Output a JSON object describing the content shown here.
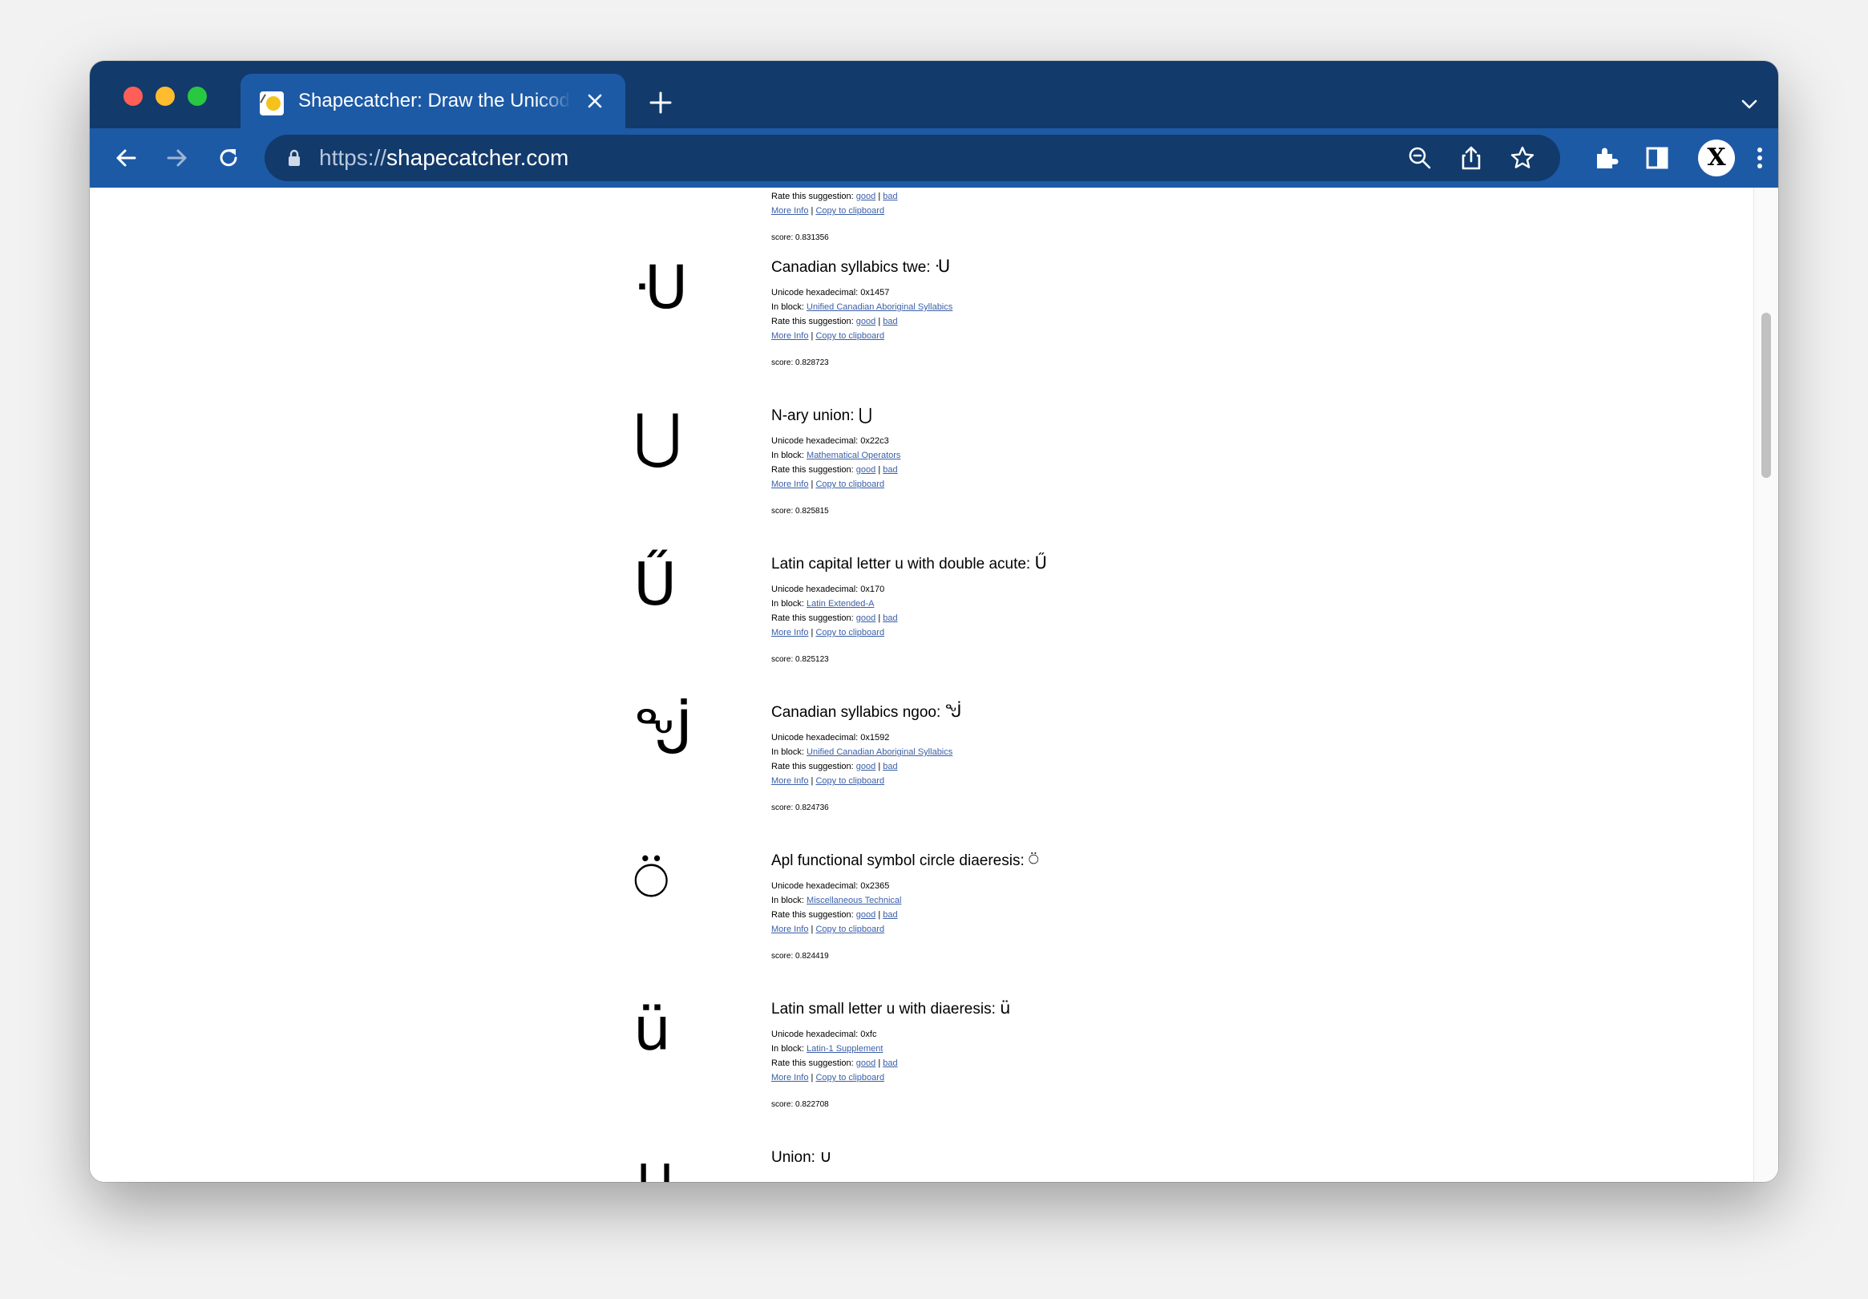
{
  "browser": {
    "tab_title": "Shapecatcher: Draw the Unicode character you want!",
    "url_scheme": "https://",
    "url_host": "shapecatcher.com",
    "profile_initial": "X"
  },
  "colors": {
    "tabbar_bg": "#123a6b",
    "toolbar_bg": "#1d5aa6",
    "link": "#3a5fa8"
  },
  "labels": {
    "rate_prefix": "Rate this suggestion: ",
    "good": "good",
    "bad": "bad",
    "separator": " | ",
    "more_info": "More Info",
    "copy": "Copy to clipboard",
    "hex_prefix": "Unicode hexadecimal: ",
    "block_prefix": "In block: ",
    "score_prefix": "score: "
  },
  "previous_entry": {
    "score": "0.831356"
  },
  "results": [
    {
      "glyph": "ᑗ",
      "name": "Canadian syllabics twe: ",
      "char": "ᑗ",
      "hex": "0x1457",
      "block": "Unified Canadian Aboriginal Syllabics",
      "score": "0.828723"
    },
    {
      "glyph": "⋃",
      "name": "N-ary union: ",
      "char": "⋃",
      "hex": "0x22c3",
      "block": "Mathematical Operators",
      "score": "0.825815"
    },
    {
      "glyph": "Ű",
      "name": "Latin capital letter u with double acute: ",
      "char": "Ű",
      "hex": "0x170",
      "block": "Latin Extended-A",
      "score": "0.825123"
    },
    {
      "glyph": "ᖒ",
      "name": "Canadian syllabics ngoo: ",
      "char": "ᖒ",
      "hex": "0x1592",
      "block": "Unified Canadian Aboriginal Syllabics",
      "score": "0.824736"
    },
    {
      "glyph": "⍥",
      "name": "Apl functional symbol circle diaeresis: ",
      "char": "⍥",
      "hex": "0x2365",
      "block": "Miscellaneous Technical",
      "score": "0.824419"
    },
    {
      "glyph": "ü",
      "name": "Latin small letter u with diaeresis: ",
      "char": "ü",
      "hex": "0xfc",
      "block": "Latin-1 Supplement",
      "score": "0.822708"
    },
    {
      "glyph": "∪",
      "name": "Union: ",
      "char": "∪",
      "hex": "",
      "block": "",
      "score": ""
    }
  ]
}
